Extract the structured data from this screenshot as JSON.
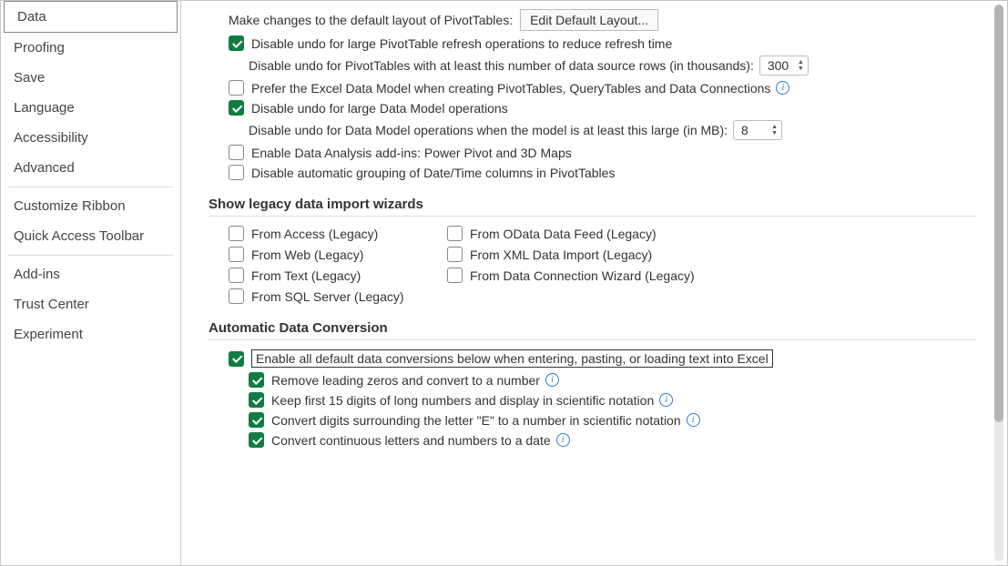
{
  "sidebar": {
    "items": [
      "Data",
      "Proofing",
      "Save",
      "Language",
      "Accessibility",
      "Advanced"
    ],
    "items2": [
      "Customize Ribbon",
      "Quick Access Toolbar"
    ],
    "items3": [
      "Add-ins",
      "Trust Center",
      "Experiment"
    ]
  },
  "pivot": {
    "layout_label": "Make changes to the default layout of PivotTables:",
    "edit_button": "Edit Default Layout...",
    "disable_undo_refresh": "Disable undo for large PivotTable refresh operations to reduce refresh time",
    "disable_undo_rows_label": "Disable undo for PivotTables with at least this number of data source rows (in thousands):",
    "rows_value": "300",
    "prefer_model": "Prefer the Excel Data Model when creating PivotTables, QueryTables and Data Connections",
    "disable_undo_model": "Disable undo for large Data Model operations",
    "disable_undo_model_mb_label": "Disable undo for Data Model operations when the model is at least this large (in MB):",
    "mb_value": "8",
    "enable_addins": "Enable Data Analysis add-ins: Power Pivot and 3D Maps",
    "disable_grouping": "Disable automatic grouping of Date/Time columns in PivotTables"
  },
  "legacy": {
    "title": "Show legacy data import wizards",
    "access": "From Access (Legacy)",
    "web": "From Web (Legacy)",
    "text": "From Text (Legacy)",
    "sql": "From SQL Server (Legacy)",
    "odata": "From OData Data Feed (Legacy)",
    "xml": "From XML Data Import (Legacy)",
    "dcw": "From Data Connection Wizard (Legacy)"
  },
  "adc": {
    "title": "Automatic Data Conversion",
    "enable_all": "Enable all default data conversions below when entering, pasting, or loading text into Excel",
    "remove_zeros": "Remove leading zeros and convert to a number",
    "keep15": "Keep first 15 digits of long numbers and display in scientific notation",
    "convert_e": "Convert digits surrounding the letter \"E\" to a number in scientific notation",
    "convert_date": "Convert continuous letters and numbers to a date"
  }
}
